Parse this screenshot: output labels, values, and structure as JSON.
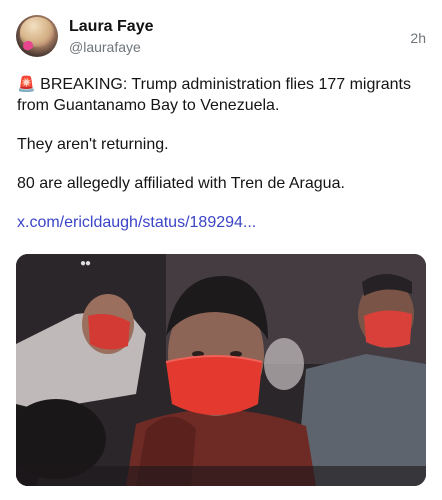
{
  "author": {
    "display_name": "Laura Faye",
    "handle": "@laurafaye"
  },
  "timestamp": "2h",
  "post": {
    "line1_emoji": "🚨",
    "line1": "BREAKING: Trump administration flies 177 migrants from Guantanamo Bay to Venezuela.",
    "line2": "They aren't returning.",
    "line3": "80 are allegedly affiliated with Tren de Aragua.",
    "link_text": "x.com/ericldaugh/status/189294..."
  },
  "icons": {
    "avatar": "profile-photo",
    "siren": "police-siren-emoji"
  },
  "colors": {
    "link": "#3b45c7",
    "secondary_text": "#6f757b",
    "mask": "#e0332c"
  }
}
